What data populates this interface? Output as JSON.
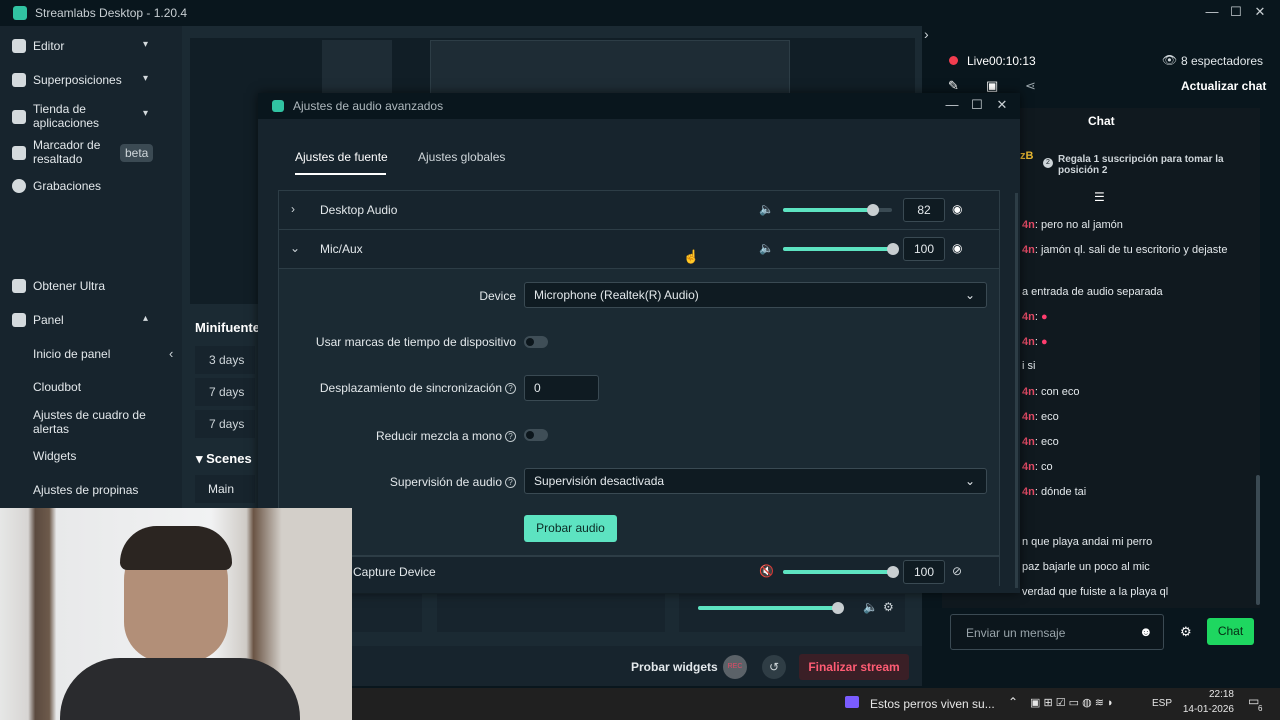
{
  "app": {
    "title": "Streamlabs Desktop - 1.20.4"
  },
  "sidebar": {
    "items": [
      {
        "label": "Editor"
      },
      {
        "label": "Superposiciones"
      },
      {
        "label": "Tienda de aplicaciones"
      },
      {
        "label": "Marcador de resaltado",
        "badge": "beta"
      },
      {
        "label": "Grabaciones"
      }
    ],
    "ultra": "Obtener Ultra",
    "panel": "Panel",
    "sub": [
      "Inicio de panel",
      "Cloudbot",
      "Ajustes de cuadro de alertas",
      "Widgets",
      "Ajustes de propinas"
    ]
  },
  "main": {
    "minifeed_title": "Minifuente",
    "feed": [
      "3 days",
      "7 days",
      "7 days"
    ],
    "scenes_title": "Scenes",
    "scene": "Main",
    "test_widgets": "Probar widgets",
    "rec": "REC",
    "end_stream": "Finalizar stream"
  },
  "right": {
    "live": "Live",
    "time": "00:10:13",
    "viewers": "8 espectadores",
    "refresh_chat": "Actualizar chat",
    "chat_title": "Chat",
    "sub_gift": "Regala 1 suscripción para tomar la posición 2",
    "sub_user": "zB",
    "messages": [
      {
        "user": "4n",
        "text": "pero no al jamón"
      },
      {
        "user": "4n",
        "text": "jamón ql. sali de tu escritorio y dejaste"
      },
      {
        "user": "",
        "text": "a entrada de audio separada"
      },
      {
        "user": "4n",
        "text": ""
      },
      {
        "user": "4n",
        "text": ""
      },
      {
        "user": "",
        "text": "i si"
      },
      {
        "user": "4n",
        "text": "con eco"
      },
      {
        "user": "4n",
        "text": "eco"
      },
      {
        "user": "4n",
        "text": "eco"
      },
      {
        "user": "4n",
        "text": "co"
      },
      {
        "user": "4n",
        "text": "dónde tai"
      },
      {
        "user": "",
        "text": "n que playa andai mi perro"
      },
      {
        "user": "",
        "text": "paz bajarle un poco al mic"
      },
      {
        "user": "",
        "text": "verdad que fuiste a la playa ql"
      }
    ],
    "input_placeholder": "Enviar un mensaje",
    "chat_button": "Chat"
  },
  "modal": {
    "title": "Ajustes de audio avanzados",
    "tabs": [
      "Ajustes de fuente",
      "Ajustes globales"
    ],
    "sources": [
      {
        "name": "Desktop Audio",
        "volume": "82",
        "level": 0.82
      },
      {
        "name": "Mic/Aux",
        "volume": "100",
        "level": 1.0
      },
      {
        "name": "Capture Device",
        "volume": "100",
        "level": 1.0
      }
    ],
    "device_label": "Device",
    "device_value": "Microphone (Realtek(R) Audio)",
    "timestamps_label": "Usar marcas de tiempo de dispositivo",
    "sync_label": "Desplazamiento de sincronización",
    "sync_value": "0",
    "mono_label": "Reducir mezcla a mono",
    "monitor_label": "Supervisión de audio",
    "monitor_value": "Supervisión desactivada",
    "test_audio": "Probar audio"
  },
  "taskbar": {
    "media": "Estos perros viven su...",
    "lang": "ESP",
    "time": "22:18",
    "date": "14-01-2026",
    "notif": "6"
  }
}
